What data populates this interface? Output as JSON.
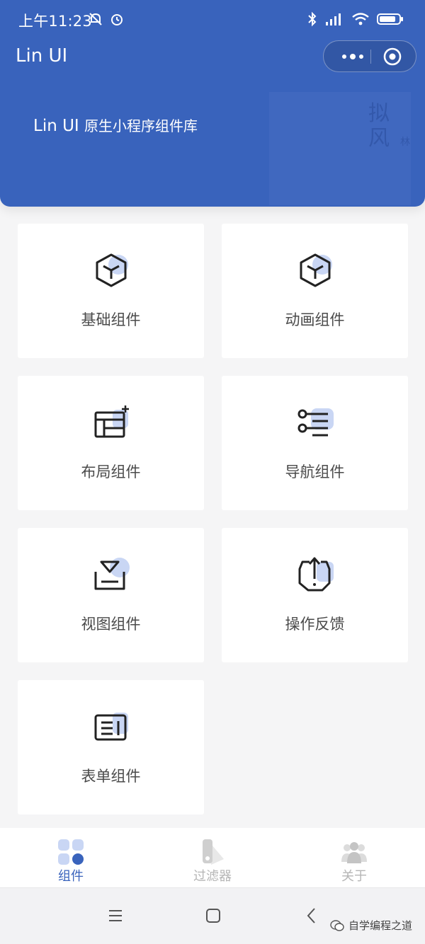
{
  "status_bar": {
    "time": "上午11:23"
  },
  "nav": {
    "title": "Lin UI"
  },
  "header": {
    "subtitle_en": "Lin UI",
    "subtitle_cn": "原生小程序组件库"
  },
  "cards": [
    {
      "label": "基础组件",
      "icon": "cube-icon"
    },
    {
      "label": "动画组件",
      "icon": "cube-icon"
    },
    {
      "label": "布局组件",
      "icon": "layout-icon"
    },
    {
      "label": "导航组件",
      "icon": "nav-list-icon"
    },
    {
      "label": "视图组件",
      "icon": "view-tray-icon"
    },
    {
      "label": "操作反馈",
      "icon": "upload-box-icon"
    },
    {
      "label": "表单组件",
      "icon": "form-icon"
    }
  ],
  "tabbar": {
    "items": [
      {
        "label": "组件",
        "active": true
      },
      {
        "label": "过滤器",
        "active": false
      },
      {
        "label": "关于",
        "active": false
      }
    ]
  },
  "watermark": {
    "text": "自学编程之道"
  },
  "colors": {
    "brand": "#3963bc",
    "accent_soft": "#c9d6f4",
    "tab_active": "#3963bc",
    "tab_inactive": "#b5b5b5"
  }
}
